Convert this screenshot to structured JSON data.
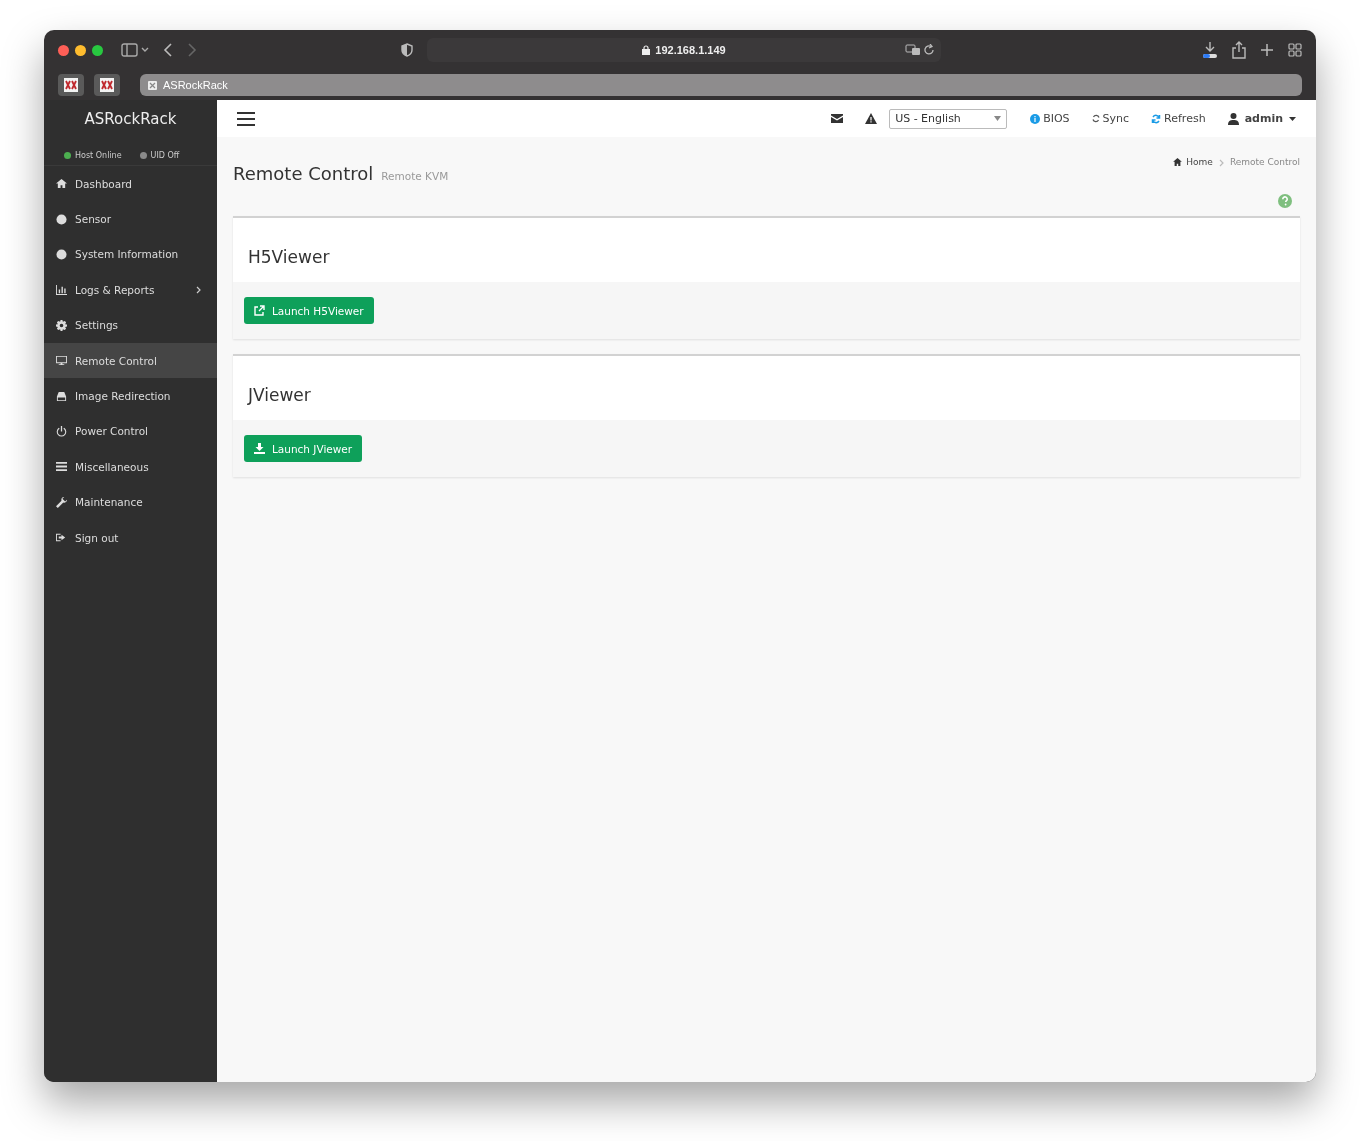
{
  "browser": {
    "address": "192.168.1.149",
    "tab_title": "ASRockRack"
  },
  "sidebar": {
    "brand": "ASRockRack",
    "status": [
      {
        "label": "Host Online",
        "color": "#4caf50"
      },
      {
        "label": "UID Off",
        "color": "#8a8a8a"
      }
    ],
    "items": [
      {
        "label": "Dashboard",
        "selected": false,
        "submenu": false
      },
      {
        "label": "Sensor",
        "selected": false,
        "submenu": false
      },
      {
        "label": "System Information",
        "selected": false,
        "submenu": false
      },
      {
        "label": "Logs & Reports",
        "selected": false,
        "submenu": true
      },
      {
        "label": "Settings",
        "selected": false,
        "submenu": false
      },
      {
        "label": "Remote Control",
        "selected": true,
        "submenu": false
      },
      {
        "label": "Image Redirection",
        "selected": false,
        "submenu": false
      },
      {
        "label": "Power Control",
        "selected": false,
        "submenu": false
      },
      {
        "label": "Miscellaneous",
        "selected": false,
        "submenu": false
      },
      {
        "label": "Maintenance",
        "selected": false,
        "submenu": false
      },
      {
        "label": "Sign out",
        "selected": false,
        "submenu": false
      }
    ]
  },
  "topbar": {
    "language": "US - English",
    "bios": "BIOS",
    "sync": "Sync",
    "refresh": "Refresh",
    "user": "admin"
  },
  "page": {
    "title": "Remote Control",
    "subtitle": "Remote KVM",
    "breadcrumb": [
      "Home",
      "Remote Control"
    ]
  },
  "panels": [
    {
      "title": "H5Viewer",
      "button": "Launch H5Viewer",
      "kind": "external"
    },
    {
      "title": "JViewer",
      "button": "Launch JViewer",
      "kind": "download"
    }
  ]
}
